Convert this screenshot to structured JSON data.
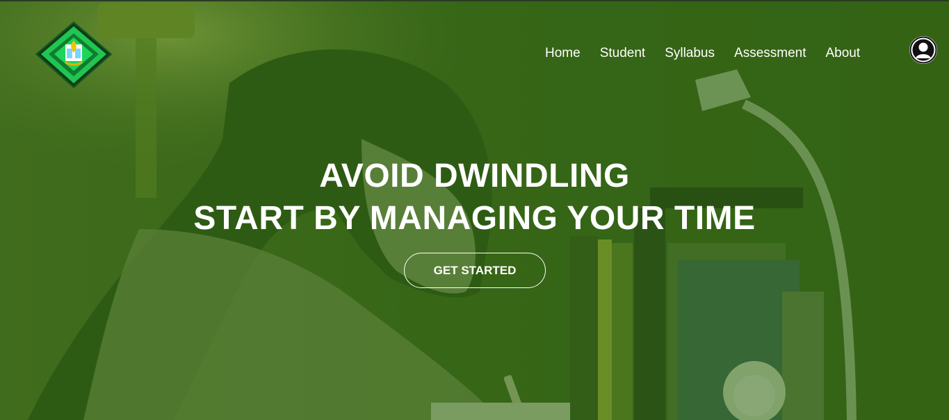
{
  "nav": {
    "items": [
      {
        "label": "Home"
      },
      {
        "label": "Student"
      },
      {
        "label": "Syllabus"
      },
      {
        "label": "Assessment"
      },
      {
        "label": "About"
      }
    ]
  },
  "hero": {
    "line1": "AVOID DWINDLING",
    "line2": "START BY MANAGING YOUR TIME",
    "cta_label": "GET STARTED"
  },
  "icons": {
    "logo": "university-seal-logo",
    "avatar": "user-avatar-icon"
  },
  "colors": {
    "overlay": "#306212",
    "text": "#ffffff",
    "logo_green": "#1fbf4a"
  }
}
